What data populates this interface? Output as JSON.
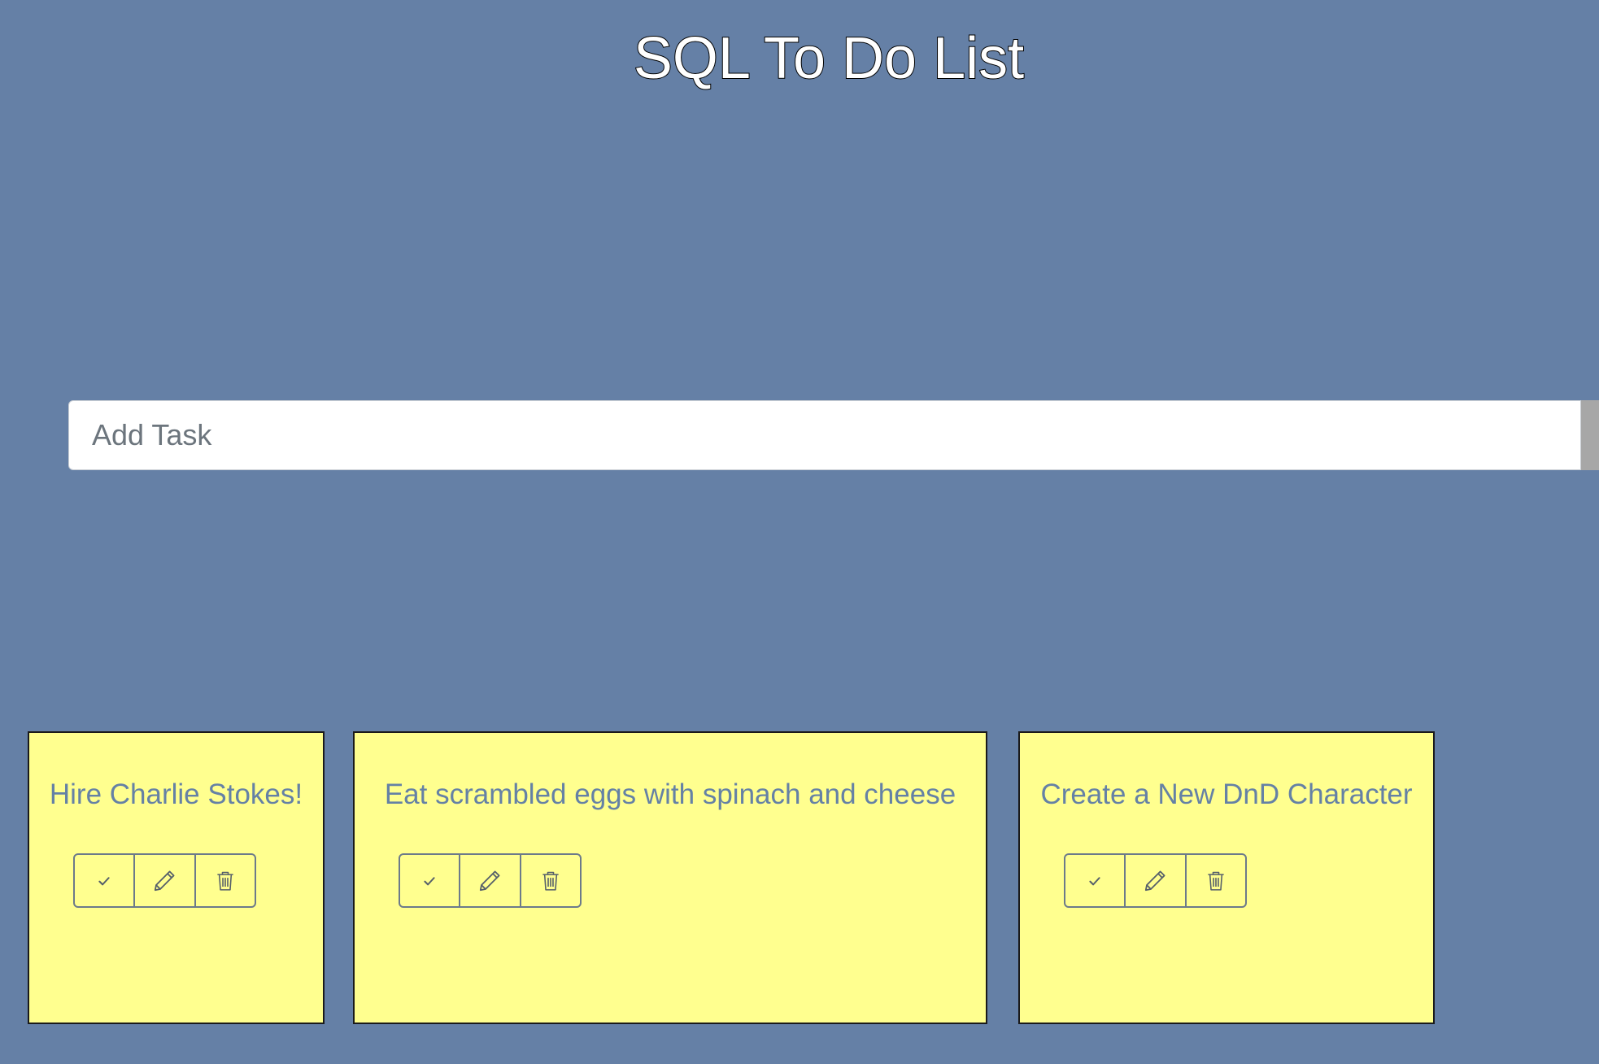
{
  "header": {
    "title": "SQL To Do List"
  },
  "add_task": {
    "placeholder": "Add Task",
    "value": ""
  },
  "tasks": [
    {
      "title": "Hire Charlie Stokes!"
    },
    {
      "title": "Eat scrambled eggs with spinach and cheese"
    },
    {
      "title": "Create a New DnD Character"
    }
  ],
  "task_actions": [
    {
      "icon": "check-icon"
    },
    {
      "icon": "pencil-icon"
    },
    {
      "icon": "trash-icon"
    }
  ],
  "colors": {
    "background": "#6580a6",
    "card": "#ffff8f",
    "task_text": "#6581a5",
    "button_border": "#6c7a8a"
  }
}
